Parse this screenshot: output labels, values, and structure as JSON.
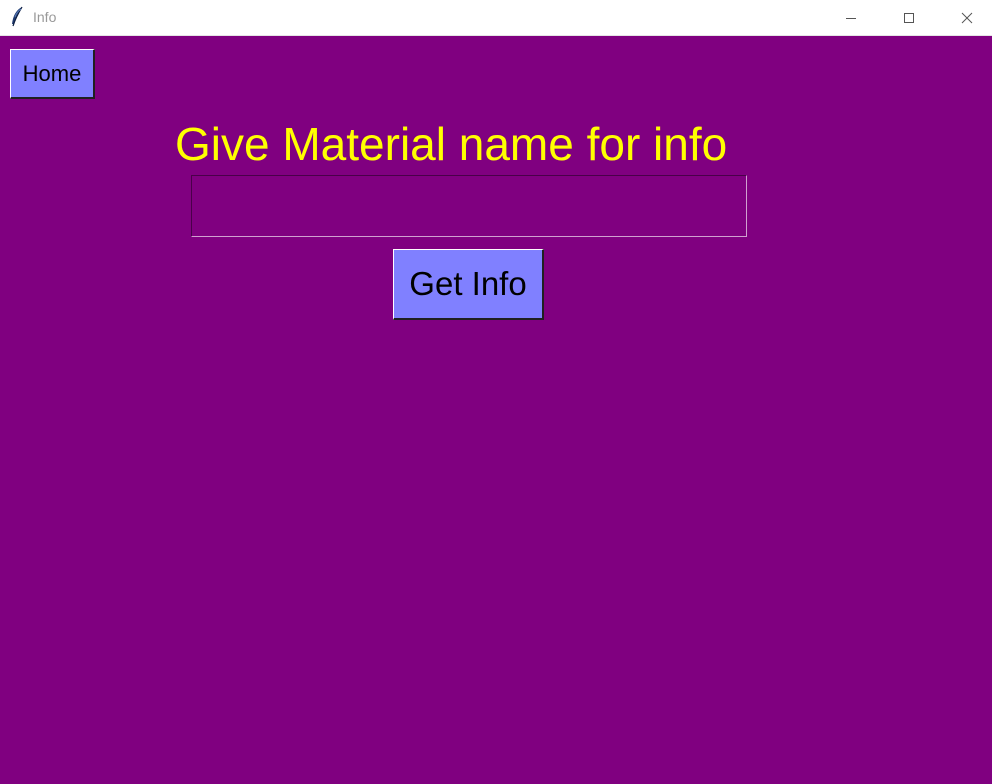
{
  "window": {
    "title": "Info",
    "app_icon": "feather-icon",
    "controls": {
      "minimize_icon": "minimize-icon",
      "maximize_icon": "maximize-icon",
      "close_icon": "close-icon"
    },
    "background_color": "#800080"
  },
  "content": {
    "home_button": {
      "label": "Home",
      "color": "#8080ff"
    },
    "heading": {
      "text": "Give Material name for info",
      "color": "#ffff00"
    },
    "material_input": {
      "value": "",
      "placeholder": ""
    },
    "get_info_button": {
      "label": "Get Info",
      "color": "#8080ff"
    }
  }
}
